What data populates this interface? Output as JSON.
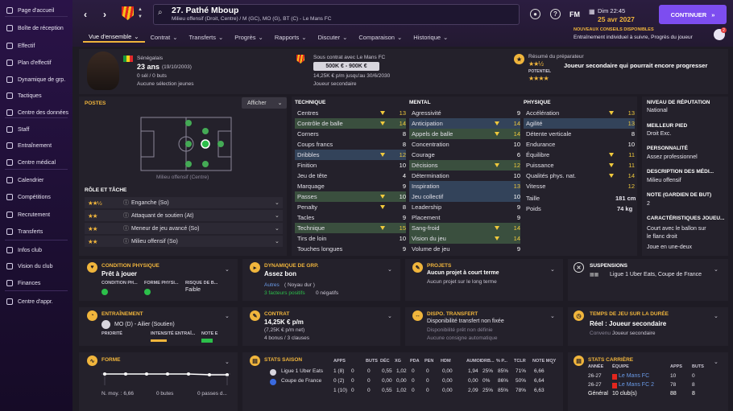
{
  "sidebar": {
    "items": [
      {
        "label": "Page d'accueil",
        "icon": "home-icon"
      },
      {
        "label": "Boîte de réception",
        "icon": "inbox-icon"
      },
      {
        "label": "Effectif",
        "icon": "squad-icon"
      },
      {
        "label": "Plan d'effectif",
        "icon": "squad-plan-icon"
      },
      {
        "label": "Dynamique de grp.",
        "icon": "dynamics-icon"
      },
      {
        "label": "Tactiques",
        "icon": "tactics-icon"
      },
      {
        "label": "Centre des données",
        "icon": "data-hub-icon"
      },
      {
        "label": "Staff",
        "icon": "staff-icon"
      },
      {
        "label": "Entraînement",
        "icon": "training-icon"
      },
      {
        "label": "Centre médical",
        "icon": "medical-icon"
      },
      {
        "label": "Calendrier",
        "icon": "calendar-icon"
      },
      {
        "label": "Compétitions",
        "icon": "trophy-icon"
      },
      {
        "label": "Recrutement",
        "icon": "scouting-icon"
      },
      {
        "label": "Transferts",
        "icon": "transfers-icon"
      },
      {
        "label": "Infos club",
        "icon": "club-info-icon"
      },
      {
        "label": "Vision du club",
        "icon": "club-vision-icon"
      },
      {
        "label": "Finances",
        "icon": "finances-icon"
      },
      {
        "label": "Centre d'appr.",
        "icon": "learning-icon"
      }
    ]
  },
  "header": {
    "player_name": "27. Pathé Mboup",
    "player_desc": "Milieu offensif (Droit, Centre) / M (GC), MO (G), BT (C) - Le Mans FC",
    "fm": "FM",
    "date_day": "Dim 22:45",
    "date_full": "25 avr 2027",
    "continue": "CONTINUER",
    "tabs": [
      "Vue d'ensemble",
      "Contrat",
      "Transferts",
      "Progrès",
      "Rapports",
      "Discuter",
      "Comparaison",
      "Historique"
    ],
    "notif_title": "NOUVEAUX CONSEILS DISPONIBLES",
    "notif_desc": "Entraînement individuel à suivre, Progrès du joueur",
    "notif_count": "2"
  },
  "profile": {
    "nationality": "Sénégalais",
    "age": "23 ans",
    "dob": "(19/10/2003)",
    "caps": "0 sél / 0 buts",
    "youth": "Aucune sélection jeunes",
    "contract_title": "Sous contrat avec Le Mans FC",
    "value": "500K € - 900K €",
    "wage": "14,25K € p/m jusqu'au 30/6/2030",
    "status": "Joueur secondaire",
    "coach_title": "Résumé du préparateur",
    "coach_text": "Joueur secondaire qui pourrait encore progresser",
    "potential_label": "POTENTIEL"
  },
  "positions": {
    "title": "POSTES",
    "show": "Afficher",
    "position_label": "Milieu offensif (Centre)",
    "roles_title": "RÔLE ET TÂCHE",
    "roles": [
      {
        "name": "Enganche (So)",
        "stars": "★★½"
      },
      {
        "name": "Attaquant de soutien (At)",
        "stars": "★★"
      },
      {
        "name": "Meneur de jeu avancé (So)",
        "stars": "★★"
      },
      {
        "name": "Milieu offensif (So)",
        "stars": "★★"
      }
    ]
  },
  "attributes": {
    "technique_title": "TECHNIQUE",
    "mental_title": "MENTAL",
    "physique_title": "PHYSIQUE",
    "technique": [
      {
        "name": "Centres",
        "value": "13"
      },
      {
        "name": "Contrôle de balle",
        "value": "14"
      },
      {
        "name": "Corners",
        "value": "8"
      },
      {
        "name": "Coups francs",
        "value": "8"
      },
      {
        "name": "Dribbles",
        "value": "12"
      },
      {
        "name": "Finition",
        "value": "10"
      },
      {
        "name": "Jeu de tête",
        "value": "4"
      },
      {
        "name": "Marquage",
        "value": "9"
      },
      {
        "name": "Passes",
        "value": "10"
      },
      {
        "name": "Penalty",
        "value": "8"
      },
      {
        "name": "Tacles",
        "value": "9"
      },
      {
        "name": "Technique",
        "value": "15"
      },
      {
        "name": "Tirs de loin",
        "value": "10"
      },
      {
        "name": "Touches longues",
        "value": "9"
      }
    ],
    "mental": [
      {
        "name": "Agressivité",
        "value": "9"
      },
      {
        "name": "Anticipation",
        "value": "14"
      },
      {
        "name": "Appels de balle",
        "value": "14"
      },
      {
        "name": "Concentration",
        "value": "10"
      },
      {
        "name": "Courage",
        "value": "6"
      },
      {
        "name": "Décisions",
        "value": "12"
      },
      {
        "name": "Détermination",
        "value": "10"
      },
      {
        "name": "Inspiration",
        "value": "13"
      },
      {
        "name": "Jeu collectif",
        "value": "10"
      },
      {
        "name": "Leadership",
        "value": "9"
      },
      {
        "name": "Placement",
        "value": "9"
      },
      {
        "name": "Sang-froid",
        "value": "14"
      },
      {
        "name": "Vision du jeu",
        "value": "14"
      },
      {
        "name": "Volume de jeu",
        "value": "9"
      }
    ],
    "physique": [
      {
        "name": "Accélération",
        "value": "13"
      },
      {
        "name": "Agilité",
        "value": "13"
      },
      {
        "name": "Détente verticale",
        "value": "8"
      },
      {
        "name": "Endurance",
        "value": "10"
      },
      {
        "name": "Équilibre",
        "value": "11"
      },
      {
        "name": "Puissance",
        "value": "11"
      },
      {
        "name": "Qualités phys. nat.",
        "value": "14"
      },
      {
        "name": "Vitesse",
        "value": "12"
      }
    ],
    "height_label": "Taille",
    "height": "181 cm",
    "weight_label": "Poids",
    "weight": "74 kg"
  },
  "info": {
    "rep_title": "NIVEAU DE RÉPUTATION",
    "rep": "National",
    "foot_title": "MEILLEUR PIED",
    "foot": "Droit Exc.",
    "pers_title": "PERSONNALITÉ",
    "pers": "Assez professionnel",
    "media_title": "DESCRIPTION DES MÉDI...",
    "media": "Milieu offensif",
    "gk_title": "NOTE (GARDIEN DE BUT)",
    "gk": "2",
    "traits_title": "CARACTÉRISTIQUES JOUEU...",
    "traits": [
      "Court avec le ballon sur",
      "le flanc droit",
      "Joue en une-deux"
    ]
  },
  "cards": {
    "cond_title": "CONDITION PHYSIQUE",
    "cond_val": "Prêt à jouer",
    "cond_cols": [
      "CONDITION PH...",
      "FORME PHYSI...",
      "RISQUE DE B..."
    ],
    "cond_risk": "Faible",
    "dyn_title": "DYNAMIQUE DE GRP.",
    "dyn_val": "Assez bon",
    "dyn_sub": "Autres",
    "dyn_sub2": "( Noyau dur )",
    "dyn_pos": "3 facteurs positifs",
    "dyn_neg": "0 négatifs",
    "proj_title": "PROJETS",
    "proj_val": "Aucun projet à court terme",
    "proj_sub": "Aucun projet sur le long terme",
    "susp_title": "SUSPENSIONS",
    "susp_val": "Ligue 1 Uber Eats, Coupe de France",
    "train_title": "ENTRAÎNEMENT",
    "train_val": "MO (D) - Ailier (Soutien)",
    "train_cols": [
      "PRIORITÉ",
      "INTENSITÉ ENTRAÎ...",
      "NOTE E"
    ],
    "contract_title": "CONTRAT",
    "contract_val": "14,25K € p/m",
    "contract_sub": "(7,25K € p/m net)",
    "contract_bonus": "4 bonus / 3 clauses",
    "dispo_title": "DISPO. TRANSFERT",
    "dispo_val": "Disponibilité transfert non fixée",
    "dispo_sub": "Disponibilité prêt non définie",
    "dispo_sub2": "Aucune consigne automatique",
    "time_title": "TEMPS DE JEU SUR LA DURÉE",
    "time_val": "Réel : Joueur secondaire",
    "time_sub": "Convenu :",
    "time_sub2": "Joueur secondaire",
    "form_title": "FORME",
    "form_avg": "N. moy. : 6,66",
    "form_goals": "0 butes",
    "form_assists": "0 passes d..."
  },
  "season": {
    "title": "STATS SAISON",
    "cols": [
      "APPS",
      "BUTS",
      "DÉC",
      "XG",
      "PDA",
      "PEN",
      "HDM",
      "AUMOI",
      "DRB...",
      "% P...",
      "TCLR",
      "NOTE MOY"
    ],
    "rows": [
      {
        "comp": "Ligue 1 Uber Eats",
        "vals": [
          "1 (8)",
          "0",
          "0",
          "0,55",
          "1,02",
          "0",
          "0",
          "0,00",
          "1,94",
          "25%",
          "85%",
          "71%",
          "6,66"
        ]
      },
      {
        "comp": "Coupe de France",
        "vals": [
          "0 (2)",
          "0",
          "0",
          "0,00",
          "0,00",
          "0",
          "0",
          "0,00",
          "0,00",
          "0%",
          "86%",
          "50%",
          "6,64"
        ]
      },
      {
        "comp": "",
        "vals": [
          "1 (10)",
          "0",
          "0",
          "0,55",
          "1,02",
          "0",
          "0",
          "0,00",
          "2,09",
          "25%",
          "85%",
          "78%",
          "6,63"
        ]
      }
    ]
  },
  "career": {
    "title": "STATS CARRIÈRE",
    "cols": [
      "ANNÉE",
      "ÉQUIPE",
      "APPS",
      "BUTS"
    ],
    "rows": [
      {
        "year": "26-27",
        "team": "Le Mans FC",
        "apps": "10",
        "goals": "0"
      },
      {
        "year": "26-27",
        "team": "Le Mans FC 2",
        "apps": "78",
        "goals": "8"
      }
    ],
    "total_label": "Général",
    "total_clubs": "10 club(s)",
    "total_apps": "88",
    "total_goals": "8"
  },
  "colors": {
    "accent": "#f0b53c",
    "continue": "#7d4df0",
    "green": "#3a4f3e",
    "blue": "#33435a"
  }
}
